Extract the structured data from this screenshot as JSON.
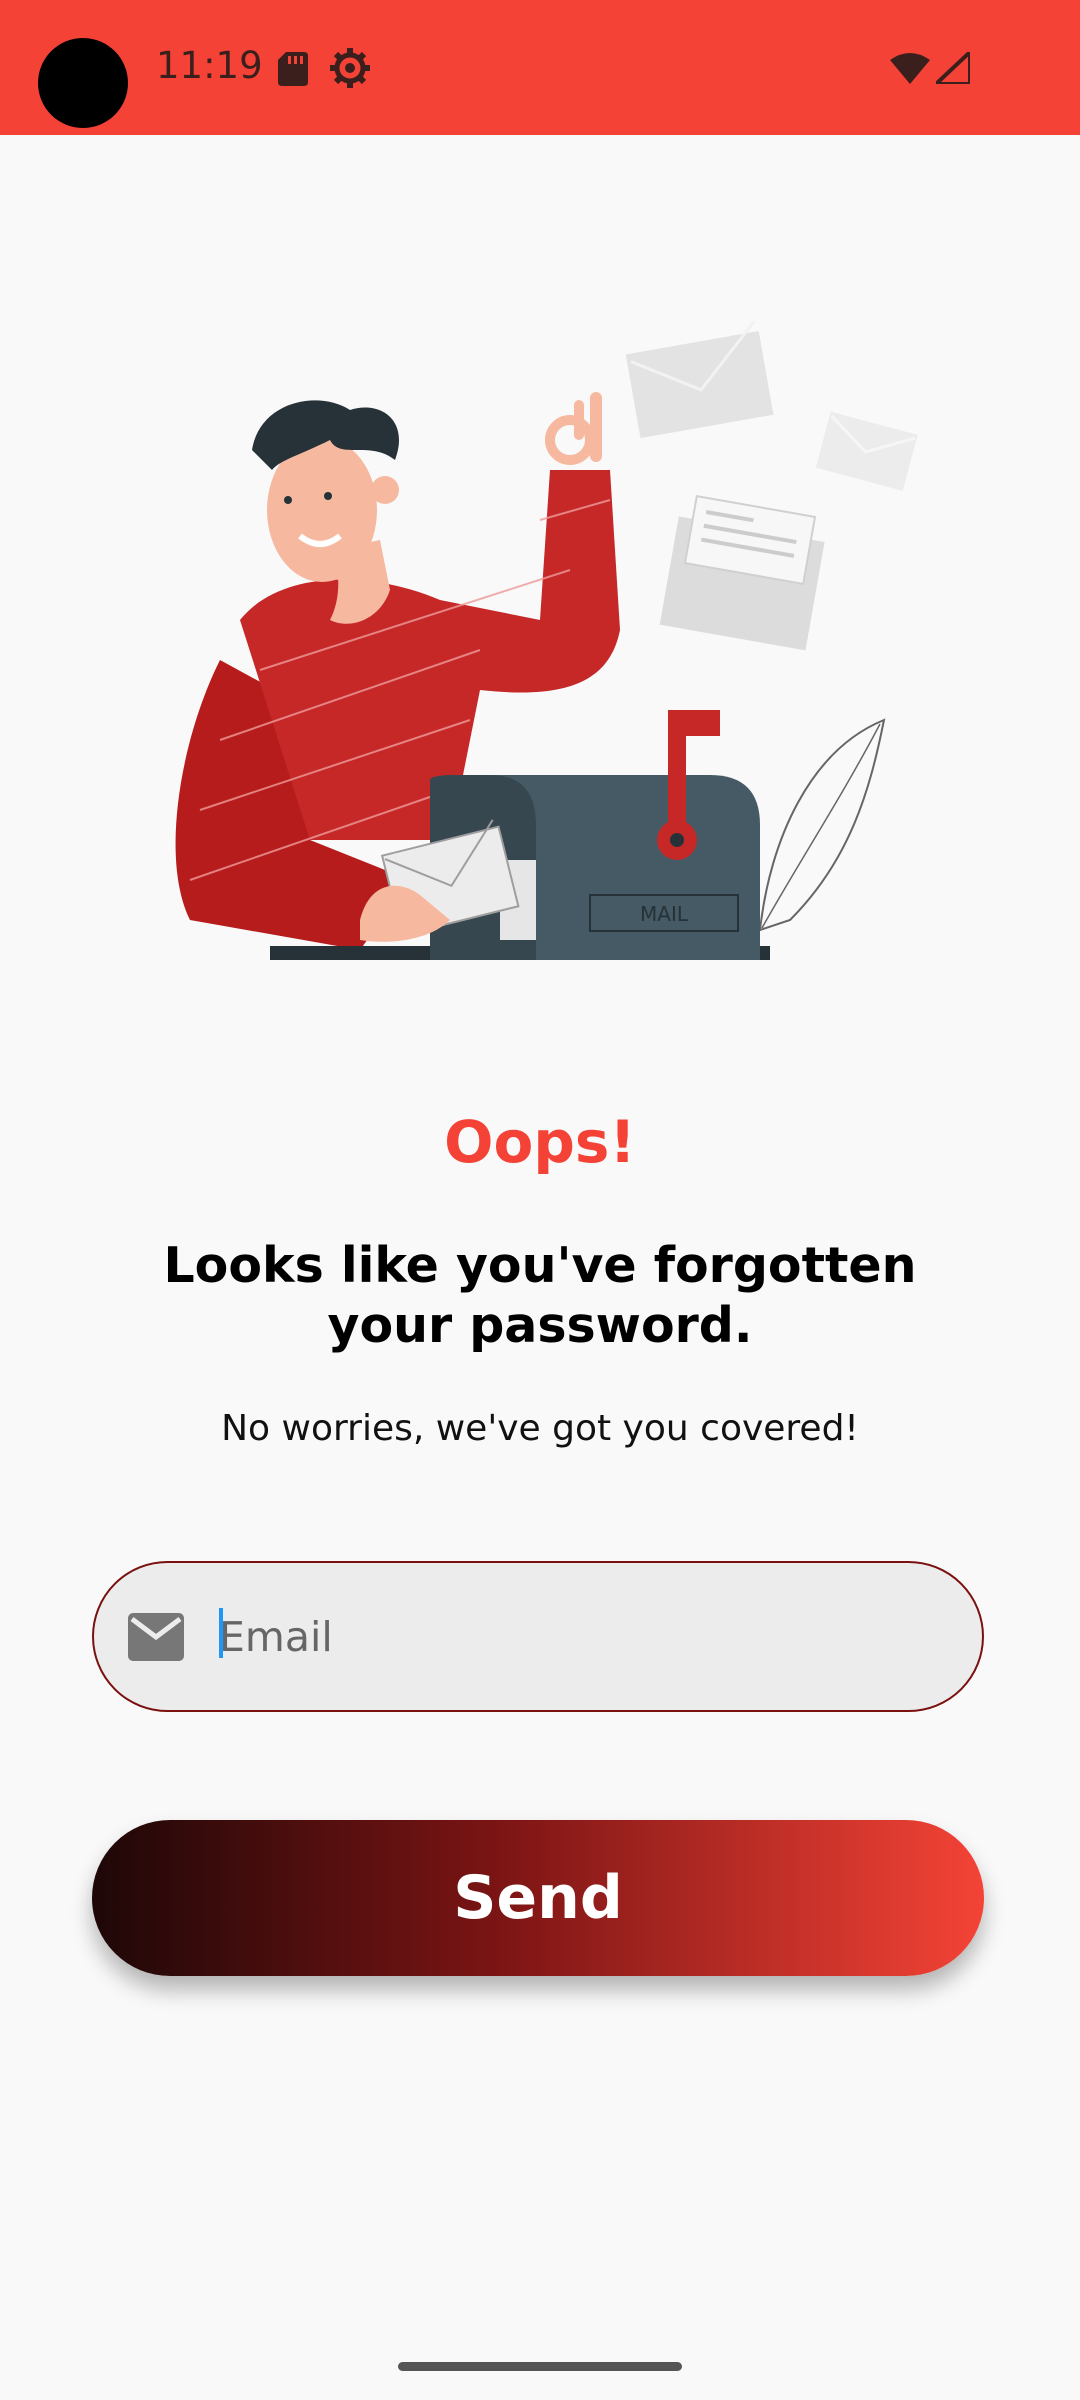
{
  "status_bar": {
    "time": "11:19",
    "icons": [
      "sd-card-icon",
      "settings-gear-icon",
      "wifi-icon",
      "cell-signal-icon"
    ],
    "color": "#f44336"
  },
  "illustration": {
    "mailbox_label": "MAIL"
  },
  "content": {
    "title": "Oops!",
    "headline": "Looks like you've forgotten your password.",
    "subtitle": "No worries, we've got you covered!"
  },
  "form": {
    "email_placeholder": "Email",
    "email_value": "",
    "send_label": "Send"
  },
  "colors": {
    "accent": "#f44336",
    "field_border": "#7a1010",
    "button_gradient_start": "#1e0707",
    "button_gradient_end": "#f44336"
  }
}
